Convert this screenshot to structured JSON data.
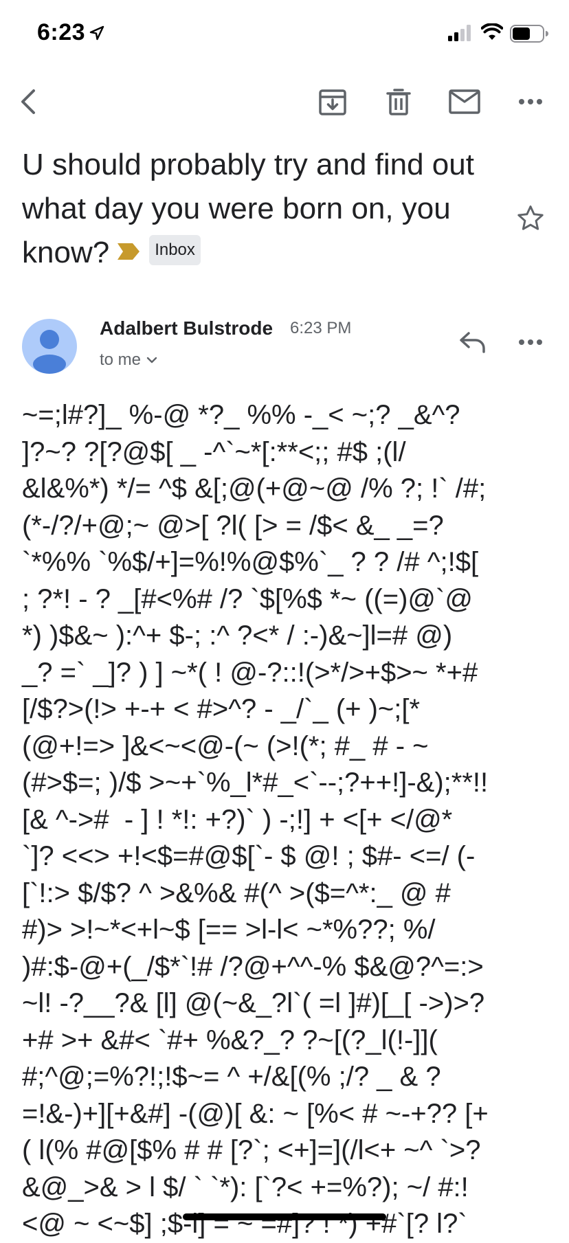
{
  "status_bar": {
    "time": "6:23"
  },
  "toolbar": {
    "back_icon": "back-arrow-icon",
    "archive_icon": "archive-icon",
    "delete_icon": "trash-icon",
    "mark_unread_icon": "mail-icon",
    "more_icon": "more-horizontal-icon"
  },
  "email": {
    "subject": "U should probably try and find out what day you were born on, you know?",
    "label": "Inbox",
    "important_color": "#c79a2c",
    "sender": {
      "name": "Adalbert Bulstrode",
      "time": "6:23 PM",
      "recipient": "to me",
      "avatar_color": "#aecbfa",
      "avatar_figure_color": "#4a7fd8"
    },
    "body": "~=;l#?]_ %-@ *?_ %% -_< ~;? _&^?\n]?~? ?[?@$[ _ -^`~*[:**<;; #$ ;(l/\n&l&%*) */= ^$ &[;@(+@~@ /% ?; !` /#;\n(*-/?/+@;~ @>[ ?l( [> = /$< &_ _=?\n`*%% `%$/+]=%!%@$%`_ ? ? /# ^;!$[\n; ?*! - ? _[#<%# /? `$[%$ *~ ((=)@`@\n*) )$&~ ):^+ $-; :^ ?<* / :-)&~]l=# @)\n_? =` _]? ) ] ~*( ! @-?::!(>*/>+$>~ *+#\n[/$?>(!> +-+ < #>^? - _/`_ (+ )~;[*\n(@+!=> ]&<~<@-(~ (>!(*; #_ # - ~\n(#>$=; )/$ >~+`%_l*#_<`--;?++!]-&);**!!\n[& ^->#  - ] ! *!: +?)` ) -;!] + <[+ </@*\n`]? <<> +!<$=#@$[`- $ @! ; $#- <=/ (-\n[`!:> $/$? ^ >&%& #(^ >($=^*:_ @ #\n#)> >!~*<+l~$ [== >l-l< ~*%??; %/\n)#:$-@+(_/$*`!# /?@+^^-% $&@?^=:>\n~l! -?__?& [l] @(~&_?l`( =l ]#)[_[ ->)>?\n+# >+ &#< `#+ %&?_? ?~[(?_l(!-]](\n#;^@;=%?!;!$~= ^ +/&[(% ;/? _ & ?\n=!&-)+][+&#] -(@)[ &: ~ [%< # ~-+?? [+\n( l(% #@[$% # # [?`; <+]=](/l<+ ~^ `>?\n&@_>& > l $/ ` `*): [`?< +=%?); ~/ #:!\n<@ ~ <~$] ;$-l] = ~ =#]? ! *) +#`[? l?`"
  }
}
